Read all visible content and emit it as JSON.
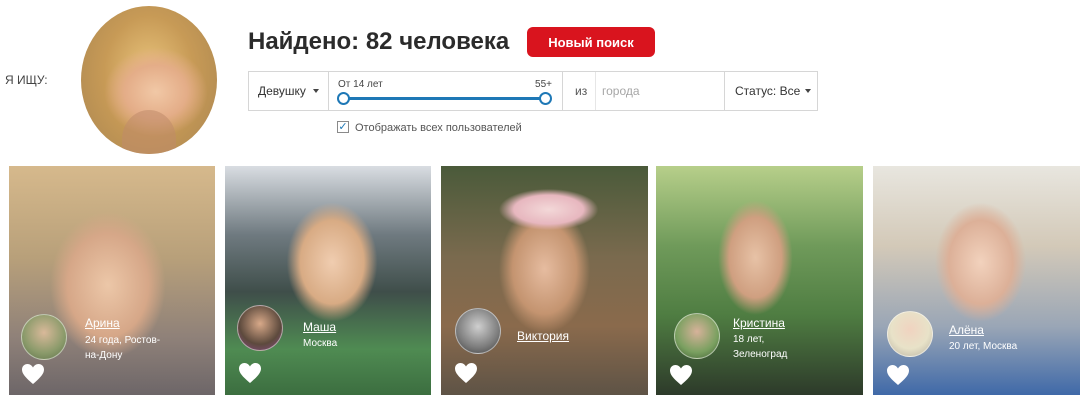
{
  "search": {
    "seeking_label": "Я ИЩУ:",
    "found_title": "Найдено: 82 человека",
    "new_search_label": "Новый поиск"
  },
  "filters": {
    "gender": "Девушку",
    "age_min_label": "От 14 лет",
    "age_max_label": "55+",
    "from_label": "из",
    "city_placeholder": "города",
    "city_value": "",
    "status": "Статус: Все",
    "show_all_label": "Отображать всех пользователей",
    "show_all_checked": true
  },
  "profiles": [
    {
      "name": "Арина",
      "age": "24 года,",
      "city": "Ростов-на-Дону"
    },
    {
      "name": "Маша",
      "age": "",
      "city": "Москва"
    },
    {
      "name": "Виктория",
      "age": "",
      "city": ""
    },
    {
      "name": "Кристина",
      "age": "18 лет,",
      "city": "Зеленоград"
    },
    {
      "name": "Алёна",
      "age": "20 лет,",
      "city": "Москва"
    }
  ],
  "colors": {
    "accent_red": "#d9141e",
    "slider_blue": "#1e78b6"
  },
  "icons": [
    "avatar",
    "chevron-down-icon",
    "checkmark-icon",
    "heart-icon"
  ]
}
